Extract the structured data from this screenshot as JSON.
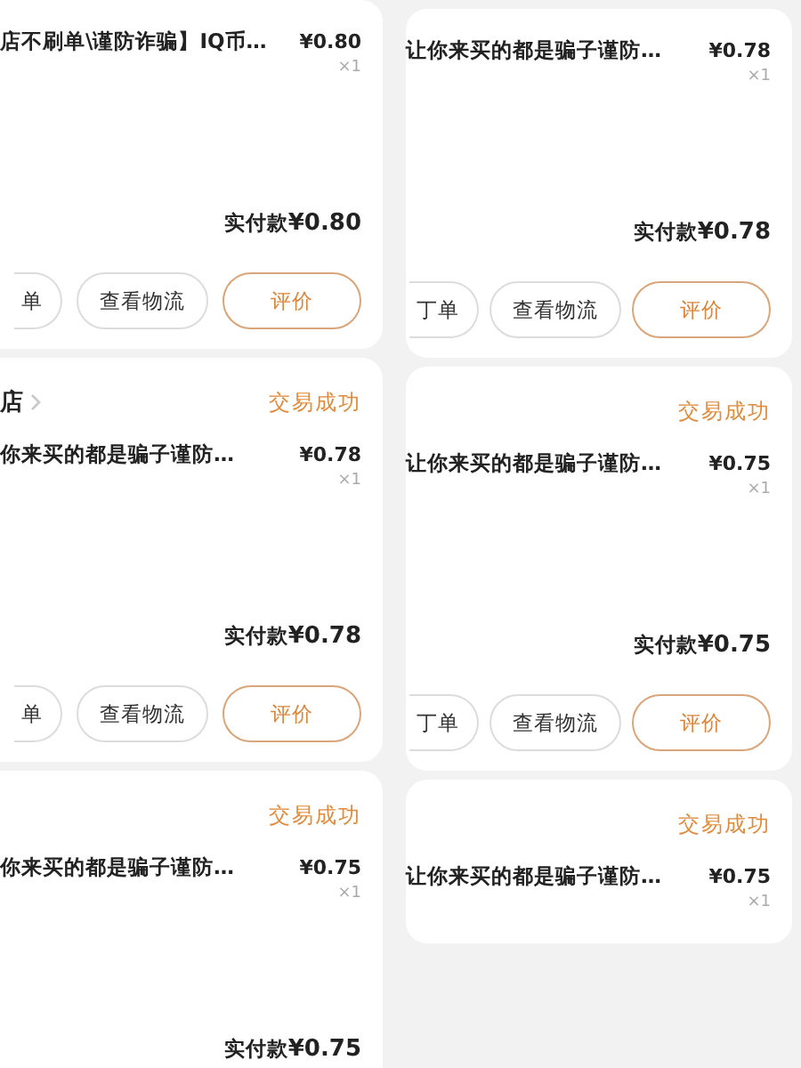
{
  "columns": [
    {
      "cards": [
        {
          "title": "店不刷单\\谨防诈骗】IQ币…",
          "price": "¥0.80",
          "quantity": "×1",
          "total_label": "实付款",
          "total": "¥0.80",
          "actions": [
            {
              "label": "单",
              "kind": "plain"
            },
            {
              "label": "查看物流",
              "kind": "plain"
            },
            {
              "label": "评价",
              "kind": "accent"
            }
          ]
        },
        {
          "shop": "店",
          "status": "交易成功",
          "title": "你来买的都是骗子谨防…",
          "price": "¥0.78",
          "quantity": "×1",
          "total_label": "实付款",
          "total": "¥0.78",
          "actions": [
            {
              "label": "单",
              "kind": "plain"
            },
            {
              "label": "查看物流",
              "kind": "plain"
            },
            {
              "label": "评价",
              "kind": "accent"
            }
          ]
        },
        {
          "status": "交易成功",
          "title": "你来买的都是骗子谨防…",
          "price": "¥0.75",
          "quantity": "×1",
          "total_label": "实付款",
          "total": "¥0.75"
        }
      ]
    },
    {
      "cards": [
        {
          "title": "让你来买的都是骗子谨防…",
          "price": "¥0.78",
          "quantity": "×1",
          "total_label": "实付款",
          "total": "¥0.78",
          "actions": [
            {
              "label": "丁单",
              "kind": "plain"
            },
            {
              "label": "查看物流",
              "kind": "plain"
            },
            {
              "label": "评价",
              "kind": "accent"
            }
          ]
        },
        {
          "status": "交易成功",
          "title": "让你来买的都是骗子谨防…",
          "price": "¥0.75",
          "quantity": "×1",
          "total_label": "实付款",
          "total": "¥0.75",
          "actions": [
            {
              "label": "丁单",
              "kind": "plain"
            },
            {
              "label": "查看物流",
              "kind": "plain"
            },
            {
              "label": "评价",
              "kind": "accent"
            }
          ]
        },
        {
          "status": "交易成功",
          "title": "让你来买的都是骗子谨防…",
          "price": "¥0.75",
          "quantity": "×1"
        }
      ]
    }
  ]
}
